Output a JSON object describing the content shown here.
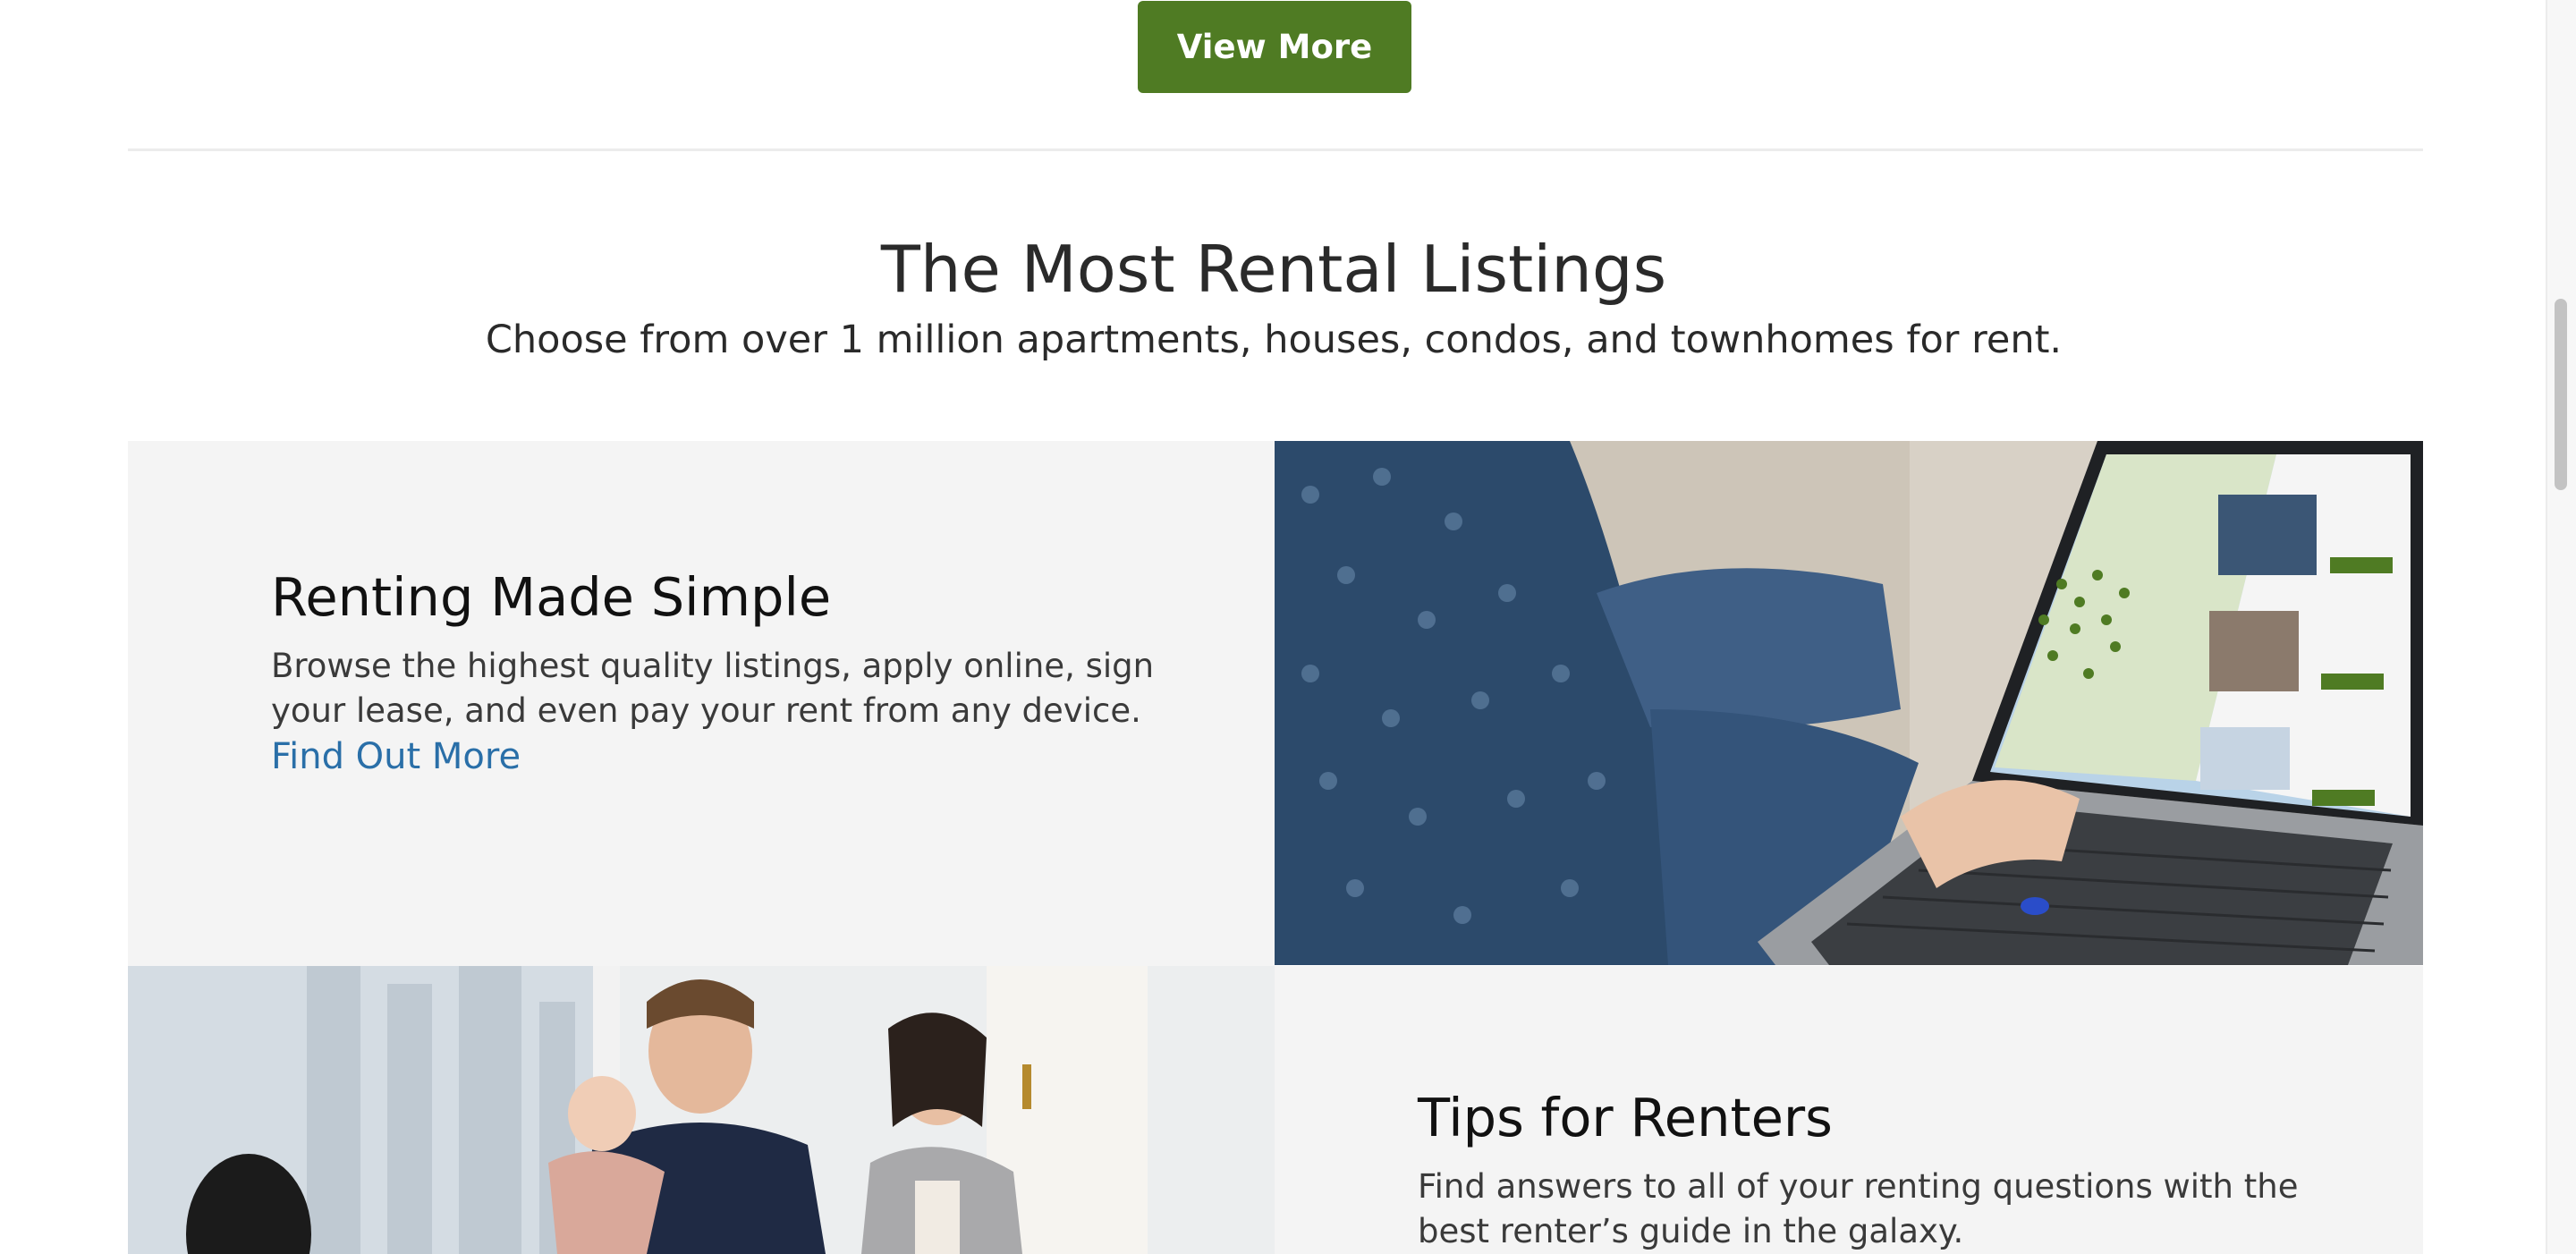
{
  "top": {
    "view_more_label": "View More"
  },
  "section": {
    "title": "The Most Rental Listings",
    "subtitle": "Choose from over 1 million apartments, houses, condos, and townhomes for rent."
  },
  "cards": [
    {
      "heading": "Renting Made Simple",
      "body": "Browse the highest quality listings, apply online, sign your lease, and even pay your rent from any device.",
      "link_label": "Find Out More",
      "image": "laptop-rental-map-photo"
    },
    {
      "heading": "Tips for Renters",
      "body": "Find answers to all of your renting questions with the best renter’s guide in the galaxy.",
      "image": "family-moving-in-photo"
    }
  ],
  "colors": {
    "brand_green": "#4f7b23",
    "link_blue": "#2a6fa8",
    "card_bg": "#f4f4f4",
    "text": "#2a2a2a"
  }
}
